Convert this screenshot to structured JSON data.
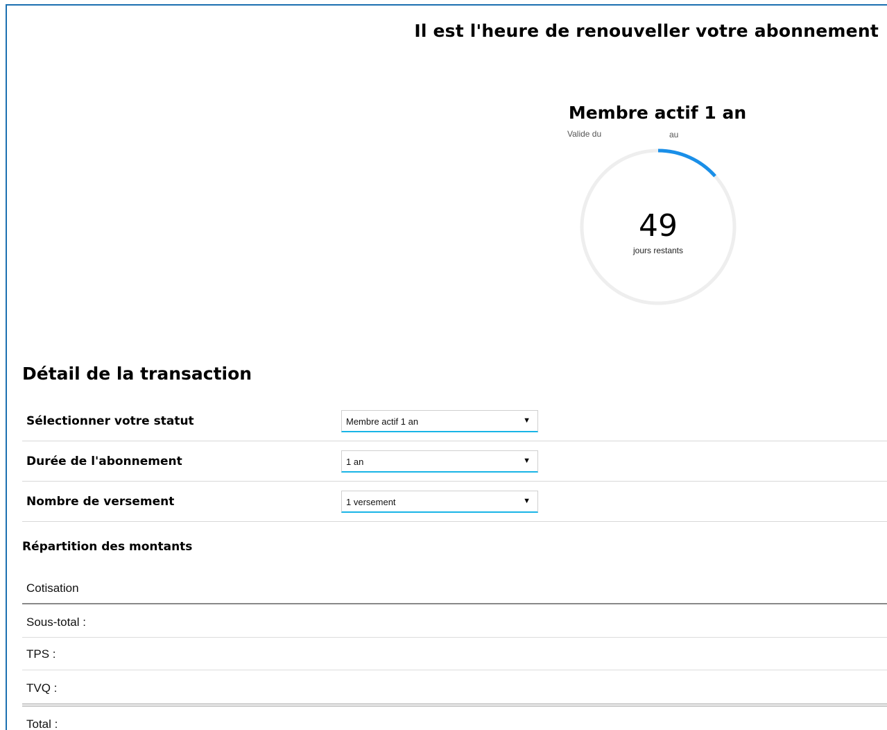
{
  "header": {
    "title": "Il est l'heure de renouveller votre abonnement"
  },
  "membership": {
    "plan_name": "Membre actif 1 an",
    "valid_from_label": "Valide du",
    "valid_to_label": "au",
    "days_remaining": "49",
    "days_remaining_label": "jours restants",
    "progress_fraction": 0.134,
    "progress_color": "#1a8fe8",
    "track_color": "#eeeeee"
  },
  "transaction": {
    "title": "Détail de la transaction",
    "fields": [
      {
        "label": "Sélectionner votre statut",
        "value": "Membre actif 1 an"
      },
      {
        "label": "Durée de l'abonnement",
        "value": "1 an"
      },
      {
        "label": "Nombre de versement",
        "value": "1 versement"
      }
    ]
  },
  "amounts": {
    "title": "Répartition des montants",
    "cotisation_label": "Cotisation",
    "subtotal_label": "Sous-total :",
    "tps_label": "TPS :",
    "tvq_label": "TVQ :",
    "total_label": "Total :"
  },
  "colors": {
    "frame_border": "#1a6fb0",
    "select_underline": "#18b4e6"
  }
}
